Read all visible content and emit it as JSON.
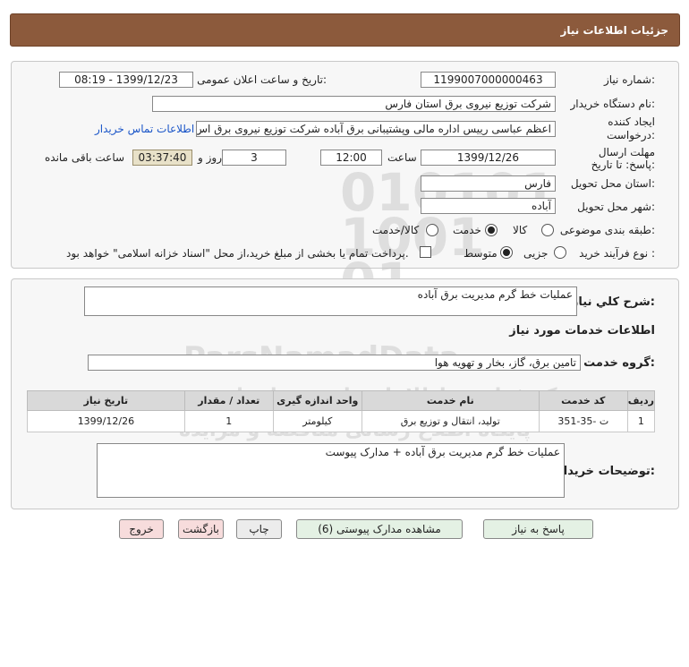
{
  "header": {
    "title": "جزئیات اطلاعات نیاز"
  },
  "fields": {
    "need_number_label": "شماره نیاز:",
    "need_number": "1199007000000463",
    "announce_label": "تاریخ و ساعت اعلان عمومی:",
    "announce_value": "1399/12/23 - 08:19",
    "buyer_org_label": "نام دستگاه خریدار:",
    "buyer_org": "شرکت توزیع نیروی برق استان فارس",
    "creator_label": "ایجاد کننده درخواست:",
    "creator": "اعظم  عباسی رییس اداره مالی وپشتیبانی برق آباده شرکت توزیع نیروی برق اس",
    "contact_link": "اطلاعات تماس خریدار",
    "deadline_label": "مهلت ارسال پاسخ: تا تاریخ:",
    "deadline_date": "1399/12/26",
    "time_label": "ساعت",
    "deadline_time": "12:00",
    "days_value": "3",
    "days_label": "روز و",
    "remaining_time": "03:37:40",
    "remaining_label": "ساعت باقی مانده",
    "province_label": "استان محل تحویل:",
    "province": "فارس",
    "city_label": "شهر محل تحویل:",
    "city": "آباده",
    "category_label": "طبقه بندی موضوعی:",
    "category_options": [
      "کالا",
      "خدمت",
      "کالا/خدمت"
    ],
    "category_selected": "خدمت",
    "process_label": "نوع فرآیند خرید :",
    "process_options": [
      "جزیی",
      "متوسط"
    ],
    "process_selected": "متوسط",
    "payment_text": "پرداخت تمام یا بخشی از مبلغ خرید،از محل \"اسناد خزانه اسلامی\" خواهد بود."
  },
  "summary": {
    "label": "شرح کلي نياز:",
    "value": "عملیات خط گرم مدیریت برق آباده"
  },
  "services": {
    "section_title": "اطلاعات خدمات مورد نیاز",
    "group_label": "گروه خدمت:",
    "group_value": "تامین برق، گاز، بخار و تهویه هوا",
    "columns": [
      "ردیف",
      "کد خدمت",
      "نام خدمت",
      "واحد اندازه گیری",
      "تعداد / مقدار",
      "تاریخ نیاز"
    ],
    "rows": [
      {
        "row": "1",
        "code": "ت -35-351",
        "name": "تولید، انتقال و توزیع برق",
        "unit": "کیلومتر",
        "qty": "1",
        "date": "1399/12/26"
      }
    ]
  },
  "buyer_notes": {
    "label": "توضیحات خریدار:",
    "value": "عملیات خط گرم مدیریت برق آباده + مدارک پیوست"
  },
  "buttons": {
    "reply": "پاسخ به نیاز",
    "attachments": "مشاهده مدارک پیوستی (6)",
    "print": "چاپ",
    "back": "بازگشت",
    "exit": "خروج"
  },
  "watermark": {
    "brand": "ParsNamadData",
    "line1": "مرکز فراوری اطلاعات پارس نماد داده",
    "line2": "پایگاه اطلاع رسانی مناقصه و مزایده",
    "phone": "۰۲۱-۸۸۳۴۹۶۷۰-۵"
  }
}
